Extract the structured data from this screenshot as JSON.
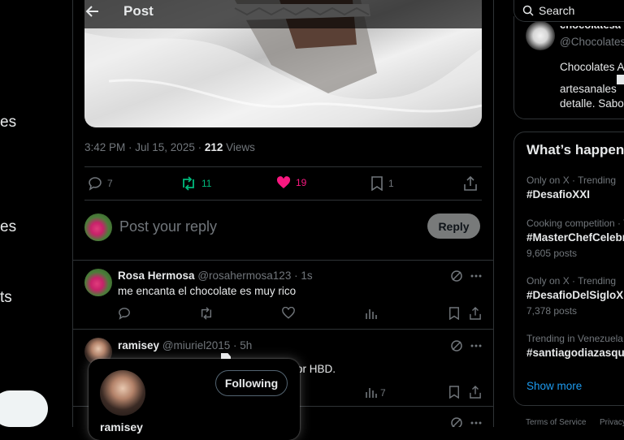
{
  "left_nav": {
    "fragments": [
      "es",
      "es",
      "ts"
    ]
  },
  "header": {
    "title": "Post"
  },
  "post": {
    "time": "3:42 PM · Jul 15, 2025 · ",
    "views_count": "212",
    "views_label": " Views",
    "replies": "7",
    "reposts": "11",
    "likes": "19",
    "bookmarks": "1"
  },
  "reply_box": {
    "placeholder": "Post your reply",
    "button": "Reply"
  },
  "comments": [
    {
      "name": "Rosa Hermosa",
      "handle": "@rosahermosa123 · 1s",
      "text": "me encanta el chocolate es muy rico"
    },
    {
      "name": "ramisey",
      "handle": "@miuriel2015 · 5h",
      "text_fragment": "or HBD.",
      "views": "7"
    }
  ],
  "hovercard": {
    "button": "Following",
    "name": "ramisey"
  },
  "right": {
    "search_placeholder": "Search",
    "profile": {
      "handle": "@Chocolates",
      "name_fragment": "chocolatesa",
      "bio": [
        "Chocolates A",
        "artesanales",
        "detalle. Sabor"
      ]
    },
    "trends_title": "What’s happen",
    "trends": [
      {
        "category": "Only on X · Trending",
        "name": "#DesafioXXI",
        "count": ""
      },
      {
        "category": "Cooking competition · T",
        "name": "#MasterChefCelebr",
        "count": "9,605 posts"
      },
      {
        "category": "Only on X · Trending",
        "name": "#DesafioDelSigloX",
        "count": "7,378 posts"
      },
      {
        "category": "Trending in Venezuela",
        "name": "#santiagodiazasque",
        "count": ""
      }
    ],
    "show_more": "Show more",
    "footer": [
      "Terms of Service",
      "Privacy"
    ]
  },
  "colors": {
    "accent": "#1d9bf0",
    "like": "#f91880",
    "repost": "#00ba7c",
    "border": "#2f3336",
    "muted": "#71767b"
  }
}
